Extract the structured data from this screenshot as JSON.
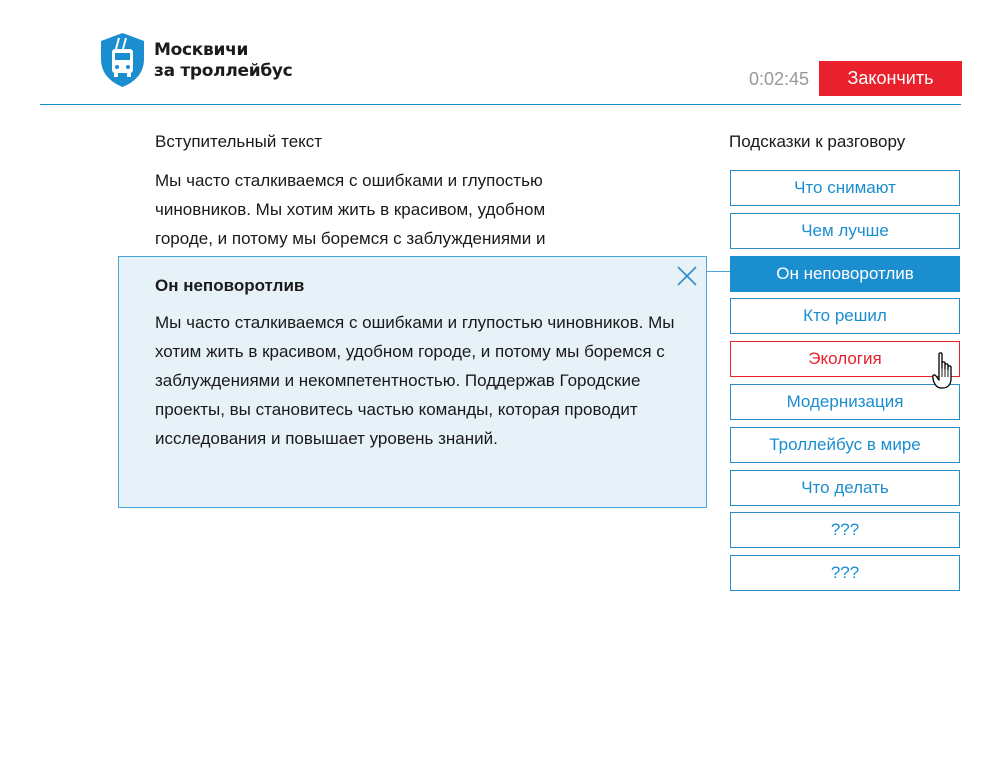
{
  "logo": {
    "line1": "Москвичи",
    "line2": "за троллейбус"
  },
  "header": {
    "timer": "0:02:45",
    "finish_label": "Закончить"
  },
  "intro": {
    "title": "Вступительный текст",
    "text": "Мы часто сталкиваемся с ошибками и глупостью чиновников. Мы хотим жить в красивом, удобном городе, и потому мы боремся с заблуждениями и"
  },
  "popup": {
    "title": "Он неповоротлив",
    "body": "Мы часто сталкиваемся с ошибками и глупостью чиновников. Мы хотим жить в красивом, удобном городе, и потому мы боремся с заблуждениями и некомпетентностью. Поддержав Городские проекты, вы становитесь частью команды, которая проводит исследования и повышает уровень знаний.",
    "close_icon": "close-icon"
  },
  "hints": {
    "title": "Подсказки к разговору",
    "items": [
      {
        "label": "Что снимают",
        "state": "default"
      },
      {
        "label": "Чем лучше",
        "state": "default"
      },
      {
        "label": "Он неповоротлив",
        "state": "active"
      },
      {
        "label": "Кто решил",
        "state": "default"
      },
      {
        "label": "Экология",
        "state": "hover"
      },
      {
        "label": "Модернизация",
        "state": "default"
      },
      {
        "label": "Троллейбус в мире",
        "state": "default"
      },
      {
        "label": "Что делать",
        "state": "default"
      },
      {
        "label": "???",
        "state": "default"
      },
      {
        "label": "???",
        "state": "default"
      }
    ]
  },
  "colors": {
    "accent_blue": "#1b8ed0",
    "finish_red": "#e8212d",
    "popup_bg": "#e6f2f8",
    "timer_gray": "#999999"
  },
  "icons": {
    "logo": "trolleybus-shield-icon",
    "cursor": "hand-pointer-icon"
  }
}
